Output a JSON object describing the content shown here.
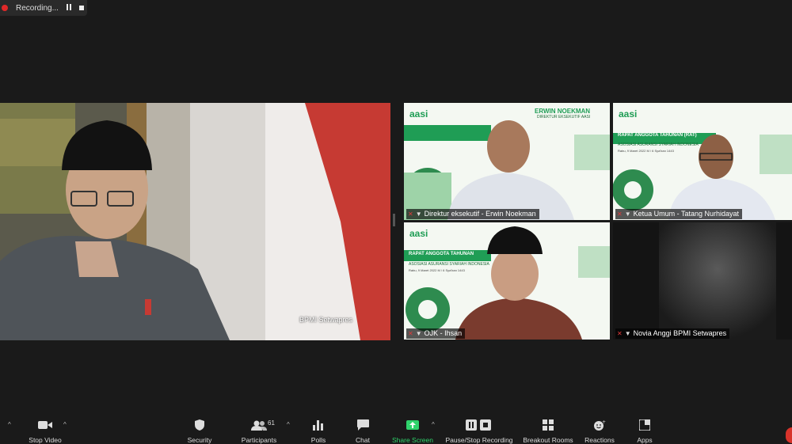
{
  "recording": {
    "label": "Recording..."
  },
  "main_speaker": {
    "name": "BPMI Setwapres"
  },
  "tiles": [
    {
      "name": "Direktur eksekutif - Erwin Noekman",
      "banner_title": "ERWIN NOEKMAN",
      "banner_subtitle": "DIREKTUR EKSEKUTIF AASI",
      "logo": "aasi"
    },
    {
      "name": "Ketua Umum - Tatang Nurhidayat",
      "banner_title": "RAPAT ANGGOTA TAHUNAN (RAT)",
      "banner_subtitle": "ASOSIASI ASURANSI SYARIAH INDONESIA",
      "date": "Rabu, 9 Maret 2022 M / 6 Sya'ban 1443",
      "logo": "aasi"
    },
    {
      "name": "OJK - Ihsan",
      "banner_title": "RAPAT ANGGOTA TAHUNAN",
      "banner_subtitle": "ASOSIASI ASURANSI SYARIAH INDONESIA",
      "date": "Rabu, 9 Maret 2022 M / 6 Sya'ban 1443",
      "logo": "aasi"
    },
    {
      "name": "Novia Anggi BPMI Setwapres"
    }
  ],
  "toolbar": {
    "stop_video": "Stop Video",
    "security": "Security",
    "participants": "Participants",
    "participants_count": "61",
    "polls": "Polls",
    "chat": "Chat",
    "share_screen": "Share Screen",
    "pause_recording": "Pause/Stop Recording",
    "breakout_rooms": "Breakout Rooms",
    "reactions": "Reactions",
    "apps": "Apps"
  },
  "colors": {
    "share_green": "#2fd36b",
    "muted_red": "#e03a3a",
    "aasi_green": "#1f9d55"
  }
}
